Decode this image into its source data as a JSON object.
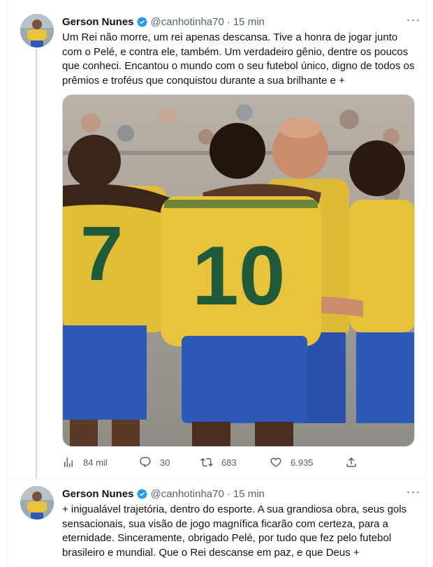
{
  "tweets": [
    {
      "author_name": "Gerson Nunes",
      "handle": "@canhotinha70",
      "separator": "·",
      "time": "15 min",
      "text": "Um Rei não morre, um rei apenas descansa. Tive a honra de jogar junto com o Pelé, e contra ele, também. Um verdadeiro gênio, dentre os poucos que conheci. Encantou o mundo com o seu futebol único, digno de todos os prêmios e troféus que conquistou durante a sua brilhante e +",
      "stats": {
        "views": "84 mil",
        "replies": "30",
        "retweets": "683",
        "likes": "6.935"
      },
      "media_jersey_number": "10",
      "media_left_number": "7"
    },
    {
      "author_name": "Gerson Nunes",
      "handle": "@canhotinha70",
      "separator": "·",
      "time": "15 min",
      "text": "+ inigualável trajetória, dentro do esporte. A sua grandiosa obra, seus gols sensacionais, sua visão de jogo magnífica ficarão com certeza, para a eternidade. Sinceramente, obrigado Pelé, por tudo que fez pelo futebol brasileiro e mundial. Que o Rei descanse em paz, e que Deus +"
    }
  ],
  "colors": {
    "verified": "#1d9bf0",
    "secondary_text": "#536471",
    "jersey_yellow": "#e9c43a",
    "shorts_blue": "#2c58b8",
    "number_green": "#1f5a3a"
  },
  "icons": [
    "verified-badge-icon",
    "more-icon",
    "views-icon",
    "reply-icon",
    "retweet-icon",
    "like-icon",
    "share-icon"
  ]
}
